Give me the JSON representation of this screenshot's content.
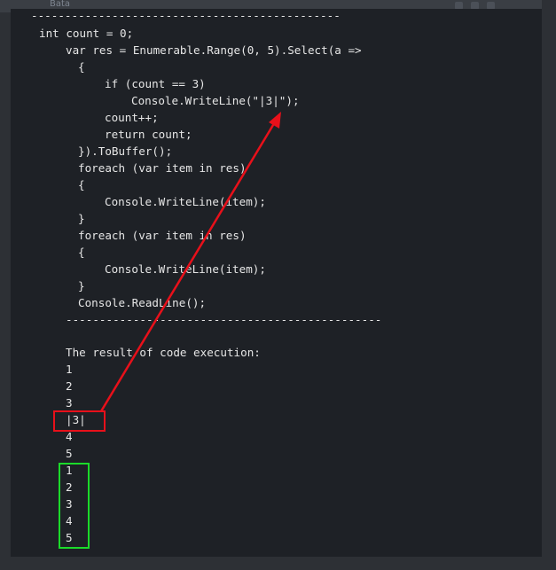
{
  "window": {
    "tab_label": "Bata"
  },
  "code": {
    "top_separator": "----------------------------------------------",
    "lines": [
      "int count = 0;",
      "var res = Enumerable.Range(0, 5).Select(a =>",
      "{",
      "if (count == 3)",
      "Console.WriteLine(\"|3|\");",
      "count++;",
      "return count;",
      "}).ToBuffer();",
      "foreach (var item in res)",
      "{",
      "Console.WriteLine(item);",
      "}",
      "foreach (var item in res)",
      "{",
      "Console.WriteLine(item);",
      "}",
      "Console.ReadLine();"
    ],
    "bottom_separator": "-----------------------------------------------"
  },
  "output": {
    "heading": "The result of code execution:",
    "lines": [
      "1",
      "2",
      "3",
      "|3|",
      "4",
      "5",
      "1",
      "2",
      "3",
      "4",
      "5"
    ]
  },
  "annotations": {
    "red_color": "#e8101a",
    "green_color": "#1bdb2a"
  }
}
